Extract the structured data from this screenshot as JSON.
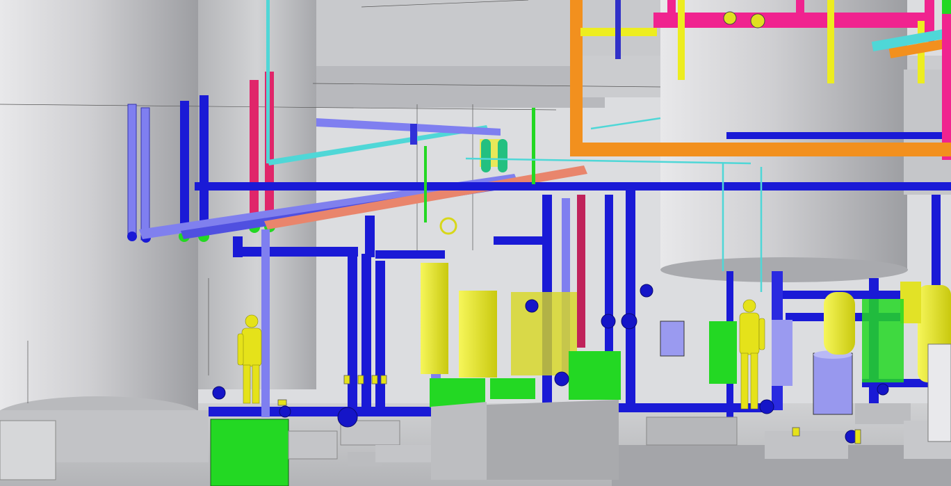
{
  "scene": {
    "description_visible_text": "",
    "palette": {
      "cold_water": "#1a1ad6",
      "light_blue": "#7f7ff0",
      "cyan": "#4fd7d7",
      "orange": "#f2901e",
      "magenta": "#e0266a",
      "hot_pink": "#f0238f",
      "yellow": "#eded20",
      "green": "#23d823",
      "concrete": "#c9c9cb",
      "shadow": "#8e8f93"
    }
  }
}
